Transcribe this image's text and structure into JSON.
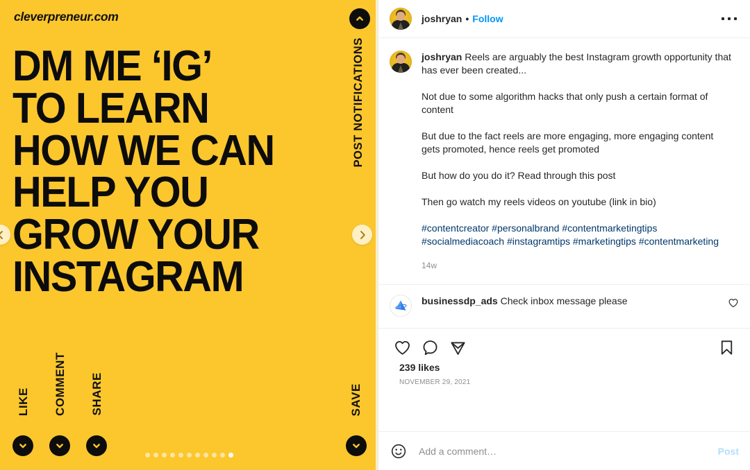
{
  "media": {
    "background_color": "#FCC62D",
    "brand_watermark": "cleverpreneur.com",
    "headline_lines": [
      "DM ME ‘IG’",
      "TO LEARN",
      "HOW WE CAN",
      "HELP YOU",
      "GROW YOUR",
      "INSTAGRAM"
    ],
    "cta_labels": {
      "like": "LIKE",
      "comment": "COMMENT",
      "share": "SHARE",
      "save": "SAVE",
      "post_notifications": "POST NOTIFICATIONS"
    },
    "icons": {
      "like_arrow": "chevron-down-circle-icon",
      "comment_arrow": "chevron-down-circle-icon",
      "share_arrow": "chevron-down-circle-icon",
      "save_arrow": "chevron-down-circle-icon",
      "notifications_arrow": "chevron-up-circle-icon",
      "prev": "chevron-left-icon",
      "next": "chevron-right-icon"
    },
    "carousel": {
      "total_slides": 11,
      "active_slide": 11
    }
  },
  "header": {
    "avatar": "user-avatar-joshryan",
    "username": "joshryan",
    "separator": "•",
    "follow_label": "Follow",
    "more_options": "more-options-icon"
  },
  "caption": {
    "avatar": "user-avatar-joshryan",
    "username": "joshryan",
    "first_paragraph": "Reels are arguably the best Instagram growth opportunity that has ever been created...",
    "paragraphs": [
      "Not due to some algorithm hacks that only push a certain format of content",
      "But due to the fact reels are more engaging, more engaging content gets promoted, hence reels get promoted",
      "But how do you do it? Read through this post",
      "Then go watch my reels videos on youtube (link in bio)"
    ],
    "hashtags": "#contentcreator #personalbrand #contentmarketingtips #socialmediacoach #instagramtips #marketingtips #contentmarketing",
    "hashtag_color": "#00376b",
    "timestamp": "14w"
  },
  "comments": [
    {
      "avatar": "user-avatar-businessdp-ads",
      "username": "businessdp_ads",
      "text": "Check inbox message please",
      "like_icon": "heart-icon"
    }
  ],
  "actions": {
    "like_icon": "heart-icon",
    "comment_icon": "comment-bubble-icon",
    "share_icon": "share-paper-plane-icon",
    "save_icon": "bookmark-icon",
    "likes_count": "239 likes",
    "date": "NOVEMBER 29, 2021"
  },
  "add_comment": {
    "emoji_icon": "emoji-smiley-icon",
    "placeholder": "Add a comment…",
    "value": "",
    "post_label": "Post",
    "post_color": "#b2dffc"
  }
}
